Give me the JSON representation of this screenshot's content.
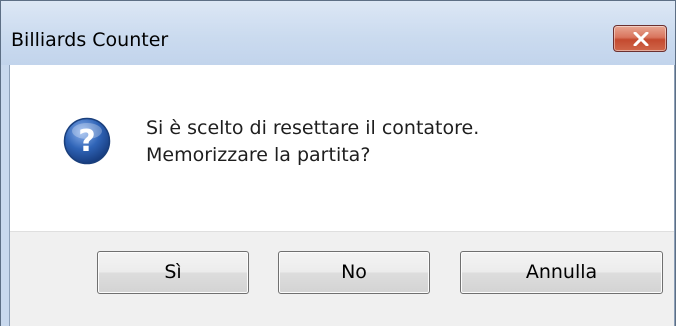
{
  "window": {
    "title": "Billiards Counter",
    "close_icon": "close-x-icon"
  },
  "message": {
    "icon": "question-icon",
    "line1": "Si è scelto di resettare il contatore.",
    "line2": "Memorizzare la partita?"
  },
  "buttons": {
    "yes_label": "Sì",
    "no_label": "No",
    "cancel_label": "Annulla"
  },
  "colors": {
    "titlebar": "#c9d9ee",
    "close_button": "#c44a2f",
    "question_icon": "#2f64b7",
    "button_area": "#f0f0f0"
  }
}
